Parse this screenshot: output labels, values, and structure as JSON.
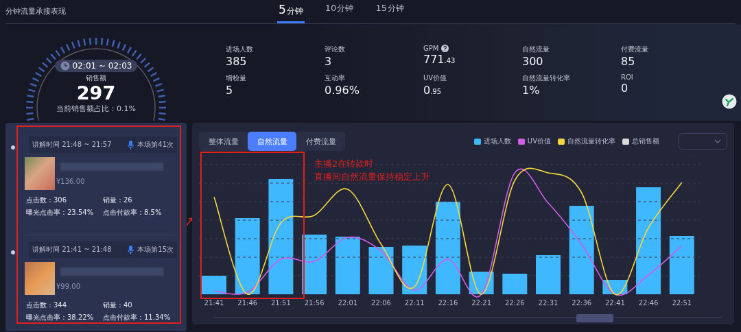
{
  "header": {
    "title": "分钟流量承接表现",
    "tabs": [
      {
        "number": "5",
        "unit": "分钟",
        "selected": true
      },
      {
        "number": "10",
        "unit": "分钟",
        "selected": false
      },
      {
        "number": "15",
        "unit": "分钟",
        "selected": false
      }
    ]
  },
  "gauge": {
    "time_range": "02:01 ~ 02:03",
    "label": "销售额",
    "value": "297",
    "share": "当前销售额占比：0.1%"
  },
  "metrics": [
    {
      "label": "进场人数",
      "value": "385"
    },
    {
      "label": "评论数",
      "value": "3"
    },
    {
      "label": "GPM",
      "value": "771",
      "fraction": ".43",
      "help": true
    },
    {
      "label": "自然流量",
      "value": "300"
    },
    {
      "label": "付费流量",
      "value": "85"
    },
    {
      "label": "增粉量",
      "value": "5"
    },
    {
      "label": "互动率",
      "value": "0.96%"
    },
    {
      "label": "UV价值",
      "value": "0",
      "fraction": ".95"
    },
    {
      "label": "自然流量转化率",
      "value": "1%"
    },
    {
      "label": "ROI",
      "value": "0"
    }
  ],
  "explanations": [
    {
      "time": "讲解时间 21:48 ~ 21:57",
      "count": "本场第41次",
      "price": "¥136.00",
      "stats": [
        "点击数：306",
        "销量：26",
        "曝光点击率：23.54%",
        "点击付款率：8.5%"
      ]
    },
    {
      "time": "讲解时间 21:41 ~ 21:48",
      "count": "本场第15次",
      "price": "¥99.00",
      "stats": [
        "点击数：344",
        "销量：40",
        "曝光点击率：38.22%",
        "点击付款率：11.34%"
      ]
    }
  ],
  "chart_panel": {
    "tabs": [
      {
        "label": "整体流量",
        "selected": false
      },
      {
        "label": "自然流量",
        "selected": true
      },
      {
        "label": "付费流量",
        "selected": false
      }
    ],
    "legend": [
      {
        "label": "进场人数",
        "color": "#40b8ff"
      },
      {
        "label": "UV价值",
        "color": "#d15ce6"
      },
      {
        "label": "自然流量转化率",
        "color": "#f5d63d"
      },
      {
        "label": "总销售额",
        "color": "#d9d9d9"
      }
    ],
    "x_labels": [
      "21:41",
      "21:46",
      "21:51",
      "21:56",
      "22:01",
      "22:06",
      "22:11",
      "22:16",
      "22:21",
      "22:26",
      "22:31",
      "22:36",
      "22:41",
      "22:46",
      "22:51"
    ],
    "annotation": [
      "主播2在转款时",
      "直播间自然流量保持稳定上升"
    ]
  }
}
